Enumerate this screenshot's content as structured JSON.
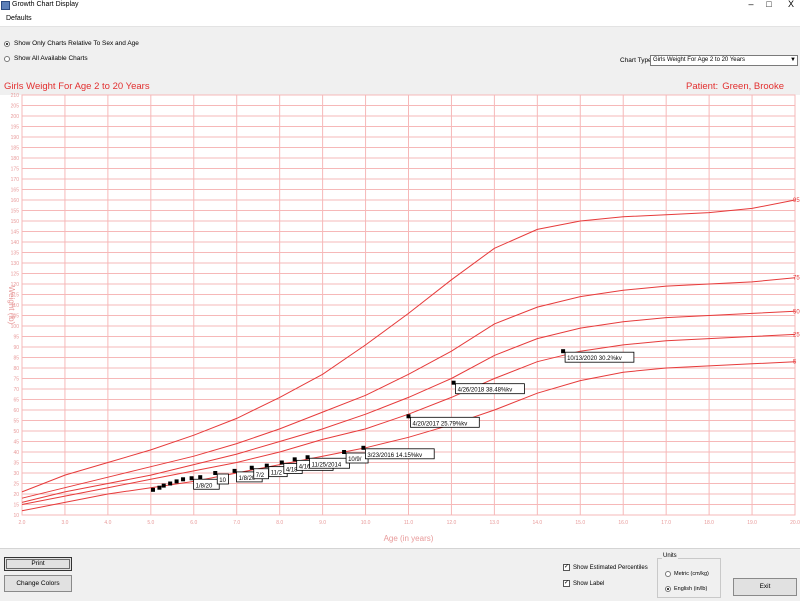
{
  "window": {
    "title": "Growth Chart Display",
    "minimize": "–",
    "maximize": "□",
    "close": "X"
  },
  "menu": {
    "defaults": "Defaults"
  },
  "filter": {
    "option_relative": "Show Only Charts Relative To Sex and Age",
    "option_all": "Show All Available Charts",
    "selected": "relative"
  },
  "chart_type": {
    "label": "Chart Type",
    "value": "Girls Weight For Age 2 to 20 Years"
  },
  "header": {
    "chart_title": "Girls Weight For Age 2 to 20 Years",
    "patient_label": "Patient:",
    "patient_name": "Green, Brooke"
  },
  "colors": {
    "grid": "#f6b8b8",
    "curve": "#e63b3b",
    "axis_text": "#e89a9a",
    "title_text": "#e23030",
    "point": "#000000"
  },
  "chart_data": {
    "type": "line",
    "xlabel": "Age (in years)",
    "ylabel": "Weight (lb)",
    "xlim": [
      2,
      20
    ],
    "ylim": [
      10,
      210
    ],
    "x_ticks": [
      "2.0",
      "3.0",
      "4.0",
      "5.0",
      "6.0",
      "7.0",
      "8.0",
      "9.0",
      "10.0",
      "11.0",
      "12.0",
      "13.0",
      "14.0",
      "15.0",
      "16.0",
      "17.0",
      "18.0",
      "19.0",
      "20.0"
    ],
    "y_ticks": [
      "10",
      "15",
      "20",
      "25",
      "30",
      "35",
      "40",
      "45",
      "50",
      "55",
      "60",
      "65",
      "70",
      "75",
      "80",
      "85",
      "90",
      "95",
      "100",
      "105",
      "110",
      "115",
      "120",
      "125",
      "130",
      "135",
      "140",
      "145",
      "150",
      "155",
      "160",
      "165",
      "170",
      "175",
      "180",
      "185",
      "190",
      "195",
      "200",
      "205",
      "210"
    ],
    "grid": true,
    "series": [
      {
        "name": "95",
        "x": [
          2,
          3,
          4,
          5,
          6,
          7,
          8,
          9,
          10,
          11,
          12,
          13,
          14,
          15,
          16,
          17,
          18,
          19,
          20
        ],
        "y": [
          21,
          29,
          35,
          41,
          48,
          56,
          66,
          77,
          91,
          106,
          122,
          137,
          146,
          150,
          152,
          153,
          154,
          156,
          160
        ]
      },
      {
        "name": "75",
        "x": [
          2,
          3,
          4,
          5,
          6,
          7,
          8,
          9,
          10,
          11,
          12,
          13,
          14,
          15,
          16,
          17,
          18,
          19,
          20
        ],
        "y": [
          18,
          23,
          28,
          33,
          38,
          44,
          51,
          59,
          67,
          77,
          88,
          101,
          109,
          114,
          117,
          119,
          120,
          121,
          123
        ]
      },
      {
        "name": "50",
        "x": [
          2,
          3,
          4,
          5,
          6,
          7,
          8,
          9,
          10,
          11,
          12,
          13,
          14,
          15,
          16,
          17,
          18,
          19,
          20
        ],
        "y": [
          16,
          21,
          25,
          29,
          34,
          39,
          45,
          51,
          58,
          66,
          75,
          86,
          94,
          99,
          102,
          104,
          105,
          106,
          107
        ]
      },
      {
        "name": "25",
        "x": [
          2,
          3,
          4,
          5,
          6,
          7,
          8,
          9,
          10,
          11,
          12,
          13,
          14,
          15,
          16,
          17,
          18,
          19,
          20
        ],
        "y": [
          15,
          19,
          23,
          27,
          31,
          35,
          40,
          46,
          51,
          58,
          66,
          75,
          83,
          88,
          91,
          93,
          94,
          95,
          96
        ]
      },
      {
        "name": "5",
        "x": [
          2,
          3,
          4,
          5,
          6,
          7,
          8,
          9,
          10,
          11,
          12,
          13,
          14,
          15,
          16,
          17,
          18,
          19,
          20
        ],
        "y": [
          12,
          16,
          20,
          23,
          26,
          30,
          34,
          38,
          42,
          47,
          53,
          60,
          68,
          74,
          78,
          80,
          81,
          82,
          83
        ]
      }
    ],
    "points": [
      {
        "x": 5.05,
        "y": 22,
        "label": ""
      },
      {
        "x": 5.2,
        "y": 23,
        "label": ""
      },
      {
        "x": 5.3,
        "y": 24,
        "label": ""
      },
      {
        "x": 5.45,
        "y": 25,
        "label": ""
      },
      {
        "x": 5.6,
        "y": 26,
        "label": ""
      },
      {
        "x": 5.75,
        "y": 27,
        "label": ""
      },
      {
        "x": 5.95,
        "y": 27.5,
        "label": "1/8/20"
      },
      {
        "x": 6.15,
        "y": 28,
        "label": ""
      },
      {
        "x": 6.5,
        "y": 30,
        "label": "10"
      },
      {
        "x": 6.95,
        "y": 31,
        "label": "1/8/20"
      },
      {
        "x": 7.35,
        "y": 32.5,
        "label": "7/2"
      },
      {
        "x": 7.7,
        "y": 33.5,
        "label": "11/2"
      },
      {
        "x": 8.05,
        "y": 35,
        "label": "4/18"
      },
      {
        "x": 8.35,
        "y": 36.5,
        "label": "4/16/2014"
      },
      {
        "x": 8.65,
        "y": 37.5,
        "label": "11/25/2014"
      },
      {
        "x": 9.5,
        "y": 40,
        "label": "10/9/"
      },
      {
        "x": 9.95,
        "y": 42,
        "label": "3/23/2016 14.15%kv"
      },
      {
        "x": 11.0,
        "y": 57,
        "label": "4/20/2017 25.79%kv"
      },
      {
        "x": 12.05,
        "y": 73,
        "label": "4/26/2018 38.48%kv"
      },
      {
        "x": 14.6,
        "y": 88,
        "label": "10/13/2020 30.2%kv"
      }
    ]
  },
  "bottom": {
    "print_button": "Print",
    "change_colors_button": "Change Colors",
    "show_estimated_percentiles": "Show Estimated Percentiles",
    "show_label": "Show Label",
    "units_legend": "Units",
    "unit_metric": "Metric (cm/kg)",
    "unit_english": "English (in/lb)",
    "exit_button": "Exit"
  }
}
